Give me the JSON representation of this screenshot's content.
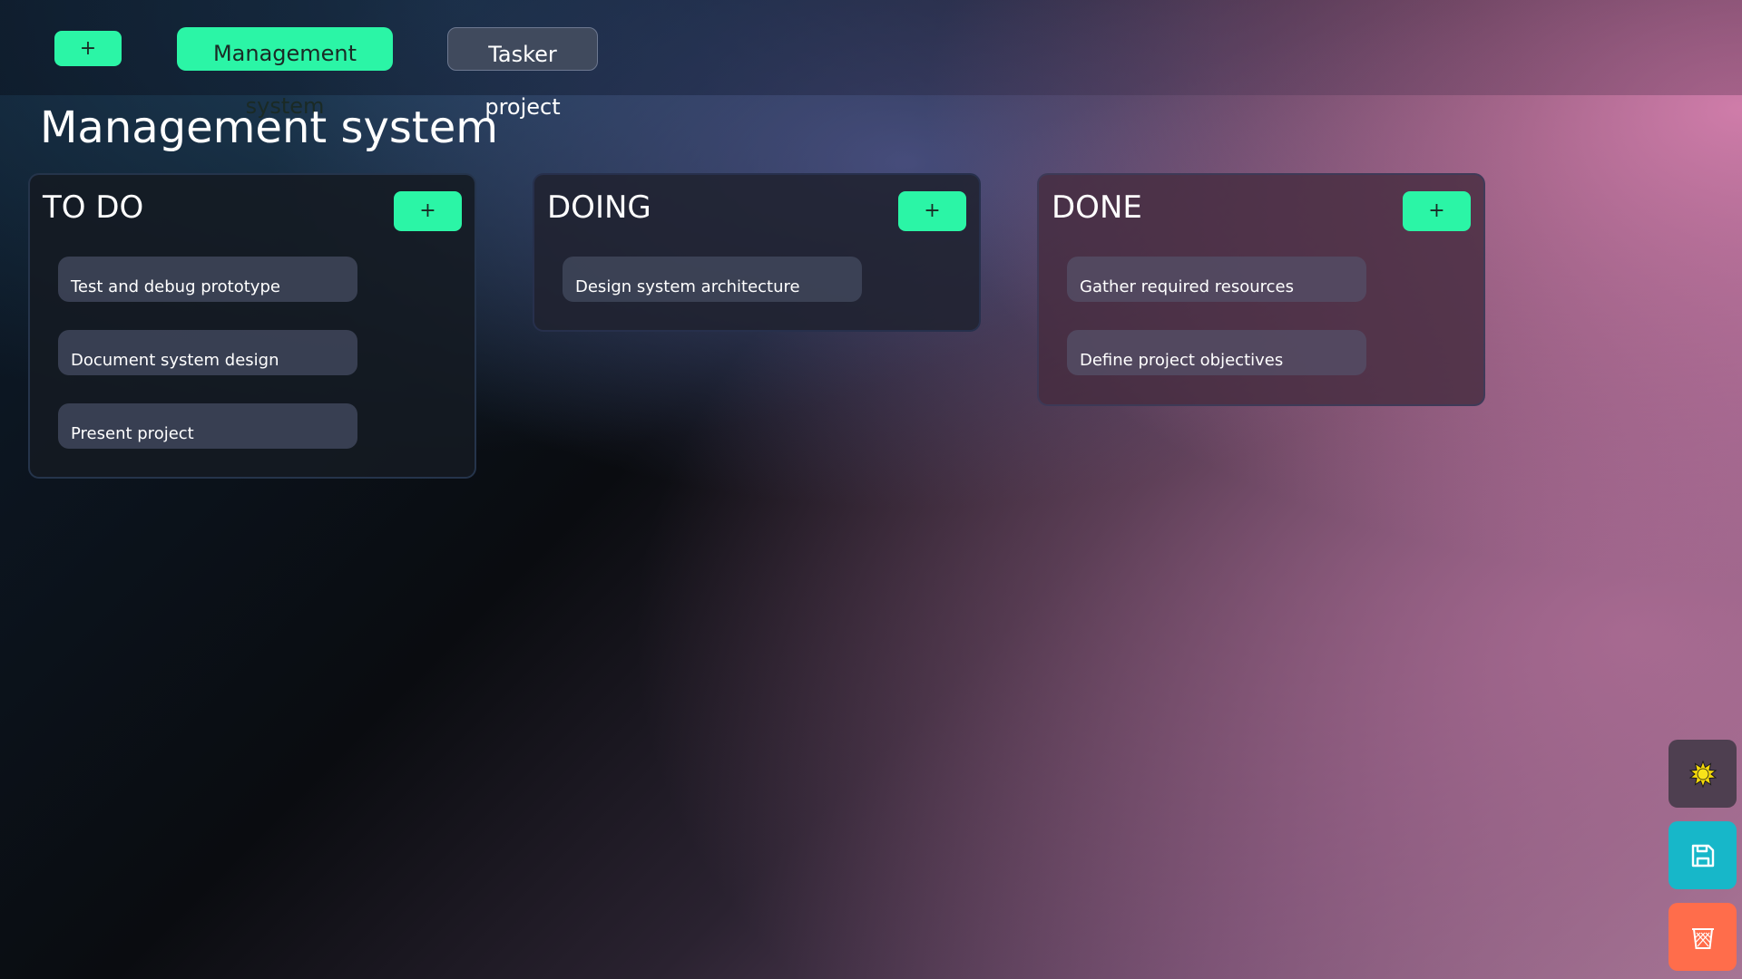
{
  "header": {
    "add_project_label": "+",
    "projects": [
      {
        "label": "Management system",
        "active": true
      },
      {
        "label": "Tasker project",
        "active": false
      }
    ]
  },
  "board": {
    "title": "Management system",
    "columns": [
      {
        "title": "TO DO",
        "add_label": "+",
        "tasks": [
          "Test and debug prototype",
          "Document system design",
          "Present project"
        ]
      },
      {
        "title": "DOING",
        "add_label": "+",
        "tasks": [
          "Design system architecture"
        ]
      },
      {
        "title": "DONE",
        "add_label": "+",
        "tasks": [
          "Gather required resources",
          "Define project objectives"
        ]
      }
    ]
  },
  "actions": {
    "theme_icon": "sun-icon",
    "save_icon": "save-icon",
    "delete_icon": "trash-icon"
  },
  "colors": {
    "accent": "#2bf5a6",
    "save": "#17b7c9",
    "delete": "#ff6d4b",
    "theme_button": "#4e3f50",
    "sun": "#f5d90a"
  }
}
